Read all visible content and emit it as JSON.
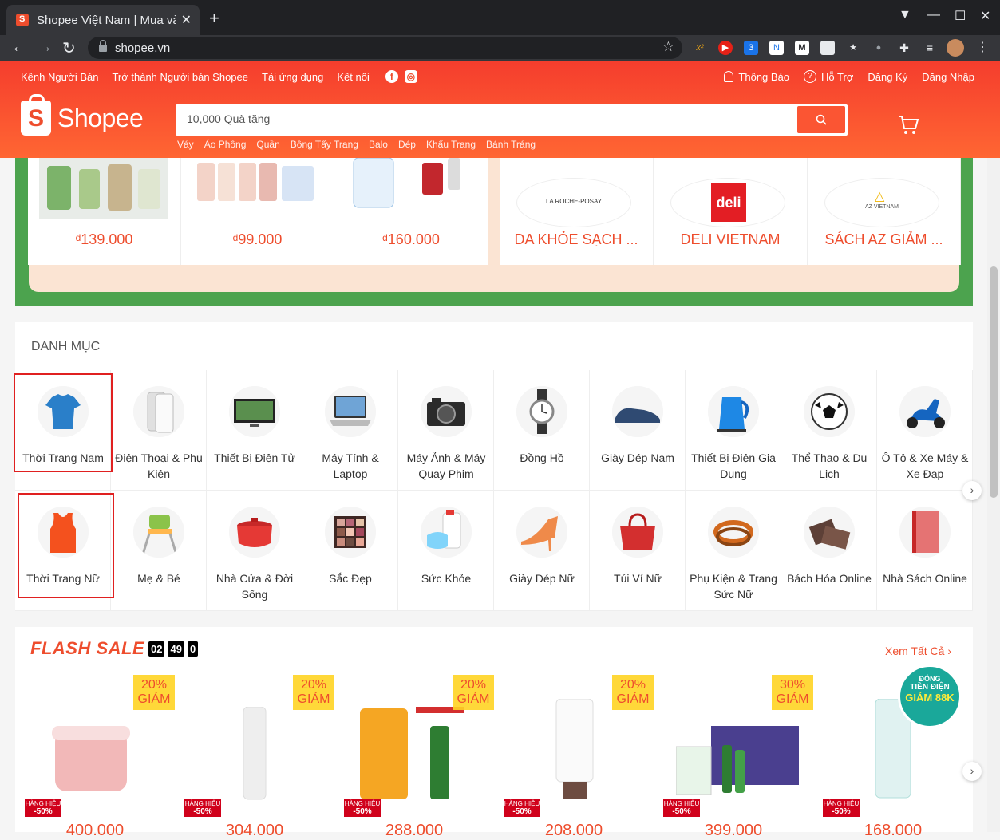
{
  "browser": {
    "tab_title": "Shopee Việt Nam | Mua và",
    "url": "shopee.vn"
  },
  "header": {
    "topnav": [
      "Kênh Người Bán",
      "Trở thành Người bán Shopee",
      "Tải ứng dụng",
      "Kết nối"
    ],
    "topright": {
      "notifications": "Thông Báo",
      "help": "Hỗ Trợ",
      "register": "Đăng Ký",
      "login": "Đăng Nhập"
    },
    "logo_text": "Shopee",
    "search_placeholder": "10,000 Quà tặng",
    "hotwords": [
      "Váy",
      "Áo Phông",
      "Quần",
      "Bông Tẩy Trang",
      "Balo",
      "Dép",
      "Khẩu Trang",
      "Bánh Tráng"
    ]
  },
  "promo": {
    "products": [
      {
        "price": "139.000",
        "currency": "đ"
      },
      {
        "price": "99.000",
        "currency": "đ"
      },
      {
        "price": "160.000",
        "currency": "đ"
      }
    ],
    "shops": [
      {
        "name": "DA KHỎE SẠCH ...",
        "logo_text": "LA ROCHE-POSAY"
      },
      {
        "name": "DELI VIETNAM",
        "logo_text": "deli"
      },
      {
        "name": "SÁCH AZ GIẢM ...",
        "logo_text": "AZ VIETNAM"
      }
    ]
  },
  "category": {
    "heading": "DANH MỤC",
    "items": [
      "Thời Trang Nam",
      "Điện Thoại & Phụ Kiện",
      "Thiết Bị Điện Tử",
      "Máy Tính & Laptop",
      "Máy Ảnh & Máy Quay Phim",
      "Đồng Hồ",
      "Giày Dép Nam",
      "Thiết Bị Điện Gia Dụng",
      "Thể Thao & Du Lịch",
      "Ô Tô & Xe Máy & Xe Đạp",
      "Thời Trang Nữ",
      "Mẹ & Bé",
      "Nhà Cửa & Đời Sống",
      "Sắc Đẹp",
      "Sức Khỏe",
      "Giày Dép Nữ",
      "Túi Ví Nữ",
      "Phụ Kiện & Trang Sức Nữ",
      "Bách Hóa Online",
      "Nhà Sách Online"
    ]
  },
  "flash_sale": {
    "title": "FLASH SALE",
    "timer": [
      "02",
      "49",
      "0"
    ],
    "see_all": "Xem Tất Cả",
    "badge": {
      "line1": "ĐÓNG",
      "line2": "TIỀN ĐIỆN",
      "line3": "GIẢM 88K"
    },
    "items": [
      {
        "discount_pct": "20%",
        "discount_word": "GIẢM",
        "mall_label": "HÀNG HIỆU",
        "mall_off": "-50%",
        "price": "400.000"
      },
      {
        "discount_pct": "20%",
        "discount_word": "GIẢM",
        "mall_label": "HÀNG HIỆU",
        "mall_off": "-50%",
        "price": "304.000"
      },
      {
        "discount_pct": "20%",
        "discount_word": "GIẢM",
        "mall_label": "HÀNG HIỆU",
        "mall_off": "-50%",
        "price": "288.000"
      },
      {
        "discount_pct": "20%",
        "discount_word": "GIẢM",
        "mall_label": "HÀNG HIỆU",
        "mall_off": "-50%",
        "price": "208.000"
      },
      {
        "discount_pct": "30%",
        "discount_word": "GIẢM",
        "mall_label": "HÀNG HIỆU",
        "mall_off": "-50%",
        "price": "399.000"
      },
      {
        "discount_pct": "",
        "discount_word": "",
        "mall_label": "HÀNG HIỆU",
        "mall_off": "-50%",
        "price": "168.000"
      }
    ]
  },
  "colors": {
    "brand": "#ee4d2d",
    "green_band": "#4ca34e",
    "highlight": "#e02020"
  }
}
